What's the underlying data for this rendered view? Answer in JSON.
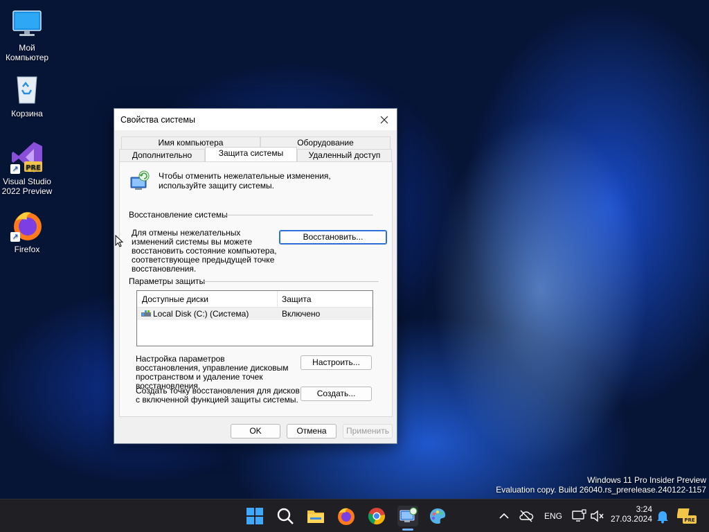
{
  "desktop": {
    "icons": [
      {
        "label": "Мой Компьютер",
        "icon": "monitor-icon"
      },
      {
        "label": "Корзина",
        "icon": "recycle-bin-icon"
      },
      {
        "label": "Visual Studio 2022 Preview",
        "icon": "visual-studio-icon",
        "badge": "PRE"
      },
      {
        "label": "Firefox",
        "icon": "firefox-icon"
      }
    ]
  },
  "dialog": {
    "title": "Свойства системы",
    "tabs": [
      {
        "label": "Имя компьютера"
      },
      {
        "label": "Оборудование"
      },
      {
        "label": "Дополнительно"
      },
      {
        "label": "Защита системы",
        "active": true
      },
      {
        "label": "Удаленный доступ"
      }
    ],
    "intro_text": "Чтобы отменить нежелательные изменения, используйте защиту системы.",
    "restore_group": {
      "title": "Восстановление системы",
      "description": "Для отмены нежелательных изменений системы вы можете восстановить состояние компьютера, соответствующее предыдущей точке восстановления.",
      "button": "Восстановить..."
    },
    "protection_group": {
      "title": "Параметры защиты",
      "columns": [
        "Доступные диски",
        "Защита"
      ],
      "rows": [
        {
          "disk": "Local Disk (C:) (Система)",
          "protection": "Включено"
        }
      ],
      "configure_text": "Настройка параметров восстановления, управление дисковым пространством и удаление точек восстановления.",
      "configure_button": "Настроить...",
      "create_text": "Создать точку восстановления для дисков с включенной функцией защиты системы.",
      "create_button": "Создать..."
    },
    "buttons": {
      "ok": "OK",
      "cancel": "Отмена",
      "apply": "Применить"
    }
  },
  "watermark": {
    "line1": "Windows 11 Pro Insider Preview",
    "line2": "Evaluation copy. Build 26040.rs_prerelease.240122-1157"
  },
  "taskbar": {
    "pinned": [
      "start-icon",
      "search-icon",
      "file-explorer-icon",
      "firefox-icon",
      "chrome-icon",
      "system-properties-icon",
      "paint-icon"
    ],
    "language": "ENG",
    "time": "3:24",
    "date": "27.03.2024"
  },
  "colors": {
    "accent": "#2b6fd8",
    "taskbar": "#1f1f24",
    "desktop": "#061436"
  }
}
